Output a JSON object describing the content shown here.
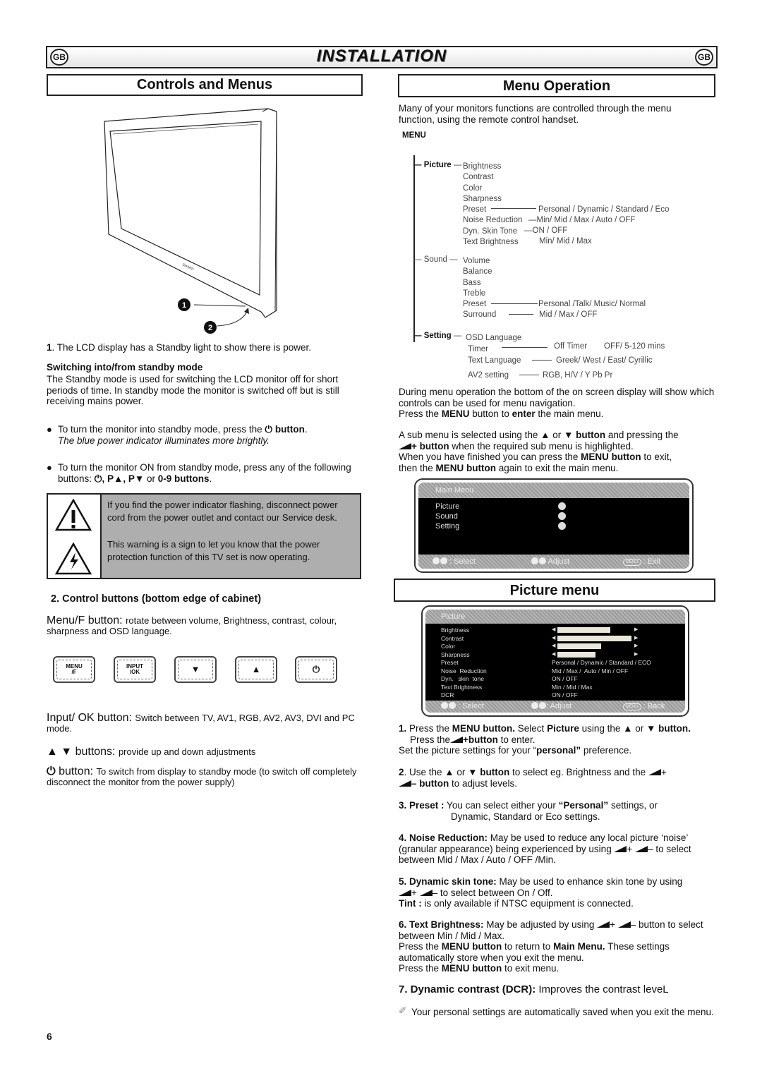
{
  "header": {
    "title": "INSTALLATION",
    "badge_left": "GB",
    "badge_right": "GB"
  },
  "left": {
    "section_title": "Controls and Menus",
    "callouts": [
      "1",
      "2"
    ],
    "caption_num": "1",
    "caption": ". The LCD display has a Standby light to show there is power.",
    "standby_heading": "Switching into/from standby mode",
    "standby_body": "The Standby mode is used for switching the LCD monitor off for short periods of time. In standby mode the monitor is switched off but is still receiving mains power.",
    "bullet1_pre": "To turn the monitor into standby mode, press the ",
    "bullet1_bold": "⏻ button",
    "bullet1_post": ".",
    "bullet1_italic": "The blue power indicator illuminates more brightly.",
    "bullet2_pre": "To turn the monitor ON from standby mode, press any of the following buttons: ",
    "bullet2_bold": "⏻, P▲, P▼",
    "bullet2_mid": " or ",
    "bullet2_bold2": "0-9 buttons",
    "bullet2_post": ".",
    "warning1": "If you find the power indicator flashing, disconnect power cord from the power outlet and contact our Service desk.",
    "warning2": "This warning is a sign to let you know that the power protection function of this TV set is now operating.",
    "controls_heading": "2. Control buttons (bottom edge of cabinet)",
    "menu_btn_label": "Menu/F button: ",
    "menu_btn_desc": "rotate  between volume, Brightness, contrast, colour, sharpness and OSD language.",
    "buttons": [
      {
        "label": "MENU\n/F"
      },
      {
        "label": "INPUT\n/OK"
      },
      {
        "label": "▼"
      },
      {
        "label": "▲"
      },
      {
        "label": "⏻"
      }
    ],
    "input_btn_label": "Input/ OK button: ",
    "input_btn_desc": "Switch between TV, AV1, RGB, AV2, AV3, DVI and PC mode.",
    "updown_glyphs": "▲  ▼",
    "updown_label": " buttons: ",
    "updown_desc": "provide up and down adjustments",
    "power_glyph": "⏻",
    "power_label": " button: ",
    "power_desc": "To switch from display to standby mode (to switch off completely disconnect the monitor from the power supply)"
  },
  "right": {
    "section_title": "Menu Operation",
    "intro": "Many of your monitors functions are controlled through the menu function, using the remote control handset.",
    "menu_label": "MENU",
    "tree": {
      "picture": {
        "label": "Picture",
        "items": [
          "Brightness",
          "Contrast",
          "Color",
          "Sharpness",
          "Preset",
          "Noise Reduction",
          "Dyn. Skin Tone",
          "Text Brightness"
        ],
        "options": {
          "preset": "Personal / Dynamic / Standard / Eco",
          "noise": "Min/ Mid / Max / Auto / OFF",
          "skin": "ON / OFF",
          "text": "Min/ Mid / Max"
        }
      },
      "sound": {
        "label": "Sound",
        "items": [
          "Volume",
          "Balance",
          "Bass",
          "Treble",
          "Preset",
          "Surround"
        ],
        "options": {
          "preset": "Personal /Talk/ Music/ Normal",
          "surround": "Mid / Max  / OFF"
        }
      },
      "setting": {
        "label": "Setting",
        "items": [
          "OSD Language",
          "Timer",
          "Text Language",
          "AV2 setting"
        ],
        "options": {
          "timer": "Off Timer",
          "timer2": "OFF/ 5-120 mins",
          "text_lang": "Greek/ West / East/ Cyrillic",
          "av2": "RGB, H/V / Y Pb Pr"
        }
      }
    },
    "nav_p1": "During menu operation the bottom of the on screen display will show which   controls can be used for menu navigation.",
    "nav_p2_pre": "Press the ",
    "nav_p2_b1": "MENU",
    "nav_p2_mid": " button to ",
    "nav_p2_b2": "enter",
    "nav_p2_post": " the main menu.",
    "sub_p1_pre": "A sub menu is selected using the ▲ or ▼ ",
    "sub_p1_b": "button",
    "sub_p1_mid": " and pressing the ",
    "sub_p1_b2": "+ button",
    "sub_p1_post": " when the required sub menu is highlighted.",
    "sub_p2_pre": "When you have finished you can press the ",
    "sub_p2_b": "MENU button",
    "sub_p2_post": " to exit,",
    "sub_p3_pre": "then the ",
    "sub_p3_b": "MENU button",
    "sub_p3_post": " again to exit the main menu.",
    "main_menu_osd": {
      "title": "Main Menu",
      "items": [
        "Picture",
        "Sound",
        "Setting"
      ],
      "footer": {
        "select": ": Select",
        "adjust": "Adjust",
        "menu_key": "MENU",
        "exit": ": Exit"
      }
    },
    "picture_section_title": "Picture menu",
    "picture_osd": {
      "title": "Picture",
      "sliders": [
        {
          "label": "Brightness",
          "value": 0.7
        },
        {
          "label": "Contrast",
          "value": 0.98
        },
        {
          "label": "Color",
          "value": 0.58
        },
        {
          "label": "Sharpness",
          "value": 0.5
        }
      ],
      "rows": [
        {
          "label": "Preset",
          "value": "Personal / Dynamic / Standard / ECO"
        },
        {
          "label": "Noise  Reduction",
          "value": "Mid / Max /  Auto / Min / OFF"
        },
        {
          "label": "Dyn.   skin  tone",
          "value": "ON / OFF"
        },
        {
          "label": "Text Brightness",
          "value": "Min / Mid / Max"
        },
        {
          "label": "DCR",
          "value": "ON / OFF"
        }
      ],
      "footer": {
        "select": ": Select",
        "adjust": ": Adjust",
        "menu_key": "MENU",
        "back": ": Back"
      }
    },
    "steps": {
      "s1_b": "1.",
      "s1_t1": " Press the ",
      "s1_b2": "MENU button.",
      "s1_t2": " Select ",
      "s1_b3": "Picture",
      "s1_t3": " using the ▲ or ▼ ",
      "s1_b4": "button.",
      "s1_l2_pre": "Press the",
      "s1_l2_b": "+button",
      "s1_l2_post": " to enter.",
      "s1_l3_pre": "Set the picture settings for your “",
      "s1_l3_b": "personal”",
      "s1_l3_post": " preference.",
      "s2_num": "2",
      "s2_t1": ". Use the ▲ or ▼ ",
      "s2_b": "button",
      "s2_t2": " to select eg. Brightness and the ",
      "s2_t3": "+",
      "s2_b2": "– button",
      "s2_t4": " to adjust levels.",
      "s3_b": "3. Preset :",
      "s3_t1": " You can select either your ",
      "s3_b2": "“Personal”",
      "s3_t2": " settings, or",
      "s3_t3": "Dynamic, Standard or Eco settings.",
      "s4_b": "4. Noise Reduction:",
      "s4_t1": " May be used to reduce any local picture ‘noise’ (granular appearance) being experienced by using ",
      "s4_t2": "+  ",
      "s4_t3": "– to select between Mid / Max / Auto / OFF /Min.",
      "s5_b": "5. Dynamic skin tone:",
      "s5_t1": " May be used to enhance skin tone by using ",
      "s5_t2": "+  ",
      "s5_t3": "– to select between On / Off.",
      "tint_b": "Tint :",
      "tint_t": " is only available if NTSC equipment is connected.",
      "s6_b": "6. Text Brightness:",
      "s6_t1": " May be adjusted by using ",
      "s6_t2": "+  ",
      "s6_t3": "– button to select between Min / Mid / Max.",
      "s6_l2_pre": "Press the ",
      "s6_l2_b": "MENU button",
      "s6_l2_mid": " to return to ",
      "s6_l2_b2": "Main Menu.",
      "s6_l2_post": " These settings automatically store when you exit the menu.",
      "s6_l3_pre": "Press the ",
      "s6_l3_b": "MENU button",
      "s6_l3_post": " to exit menu.",
      "s7_b": "7. Dynamic contrast (DCR):",
      "s7_t": " Improves the contrast leveL",
      "note": "Your personal settings are automatically saved when you exit the menu."
    }
  },
  "page_number": "6"
}
